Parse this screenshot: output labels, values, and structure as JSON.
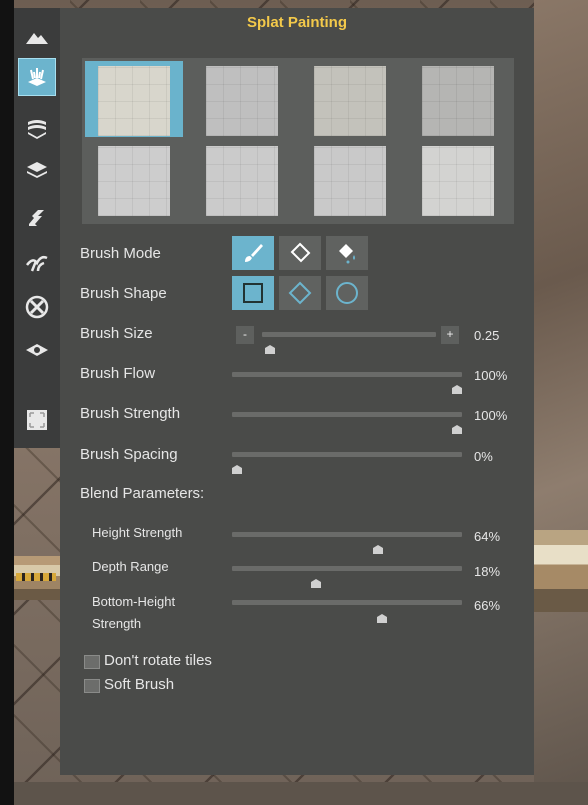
{
  "panel": {
    "title": "Splat Painting"
  },
  "sidebar": {
    "items": [
      {
        "name": "terrain-icon"
      },
      {
        "name": "splat-paint-icon",
        "active": true
      },
      {
        "name": "texture-layers-icon"
      },
      {
        "name": "layers-icon"
      },
      {
        "name": "path-tool-icon"
      },
      {
        "name": "vegetation-icon"
      },
      {
        "name": "remove-icon"
      },
      {
        "name": "eye-icon"
      },
      {
        "name": "fullscreen-icon"
      }
    ]
  },
  "tiles": [
    {
      "color": "#d8d6cc",
      "selected": true
    },
    {
      "color": "#bfbfbf"
    },
    {
      "color": "#c3c2bb"
    },
    {
      "color": "#b5b5b3"
    },
    {
      "color": "#cdcdcd"
    },
    {
      "color": "#cbcbcb"
    },
    {
      "color": "#c9c9c9"
    },
    {
      "color": "#d3d3d1"
    }
  ],
  "brush_mode": {
    "label": "Brush Mode",
    "options": [
      "brush-icon",
      "eraser-icon",
      "fill-bucket-icon"
    ],
    "selected": 0
  },
  "brush_shape": {
    "label": "Brush Shape",
    "options": [
      "square-shape-icon",
      "diamond-shape-icon",
      "circle-shape-icon"
    ],
    "selected": 0
  },
  "brush_size": {
    "label": "Brush Size",
    "value": "0.25",
    "minus": "-",
    "plus": "+",
    "fraction": 0.02
  },
  "brush_flow": {
    "label": "Brush Flow",
    "value": "100%",
    "fraction": 1.0
  },
  "brush_strength": {
    "label": "Brush Strength",
    "value": "100%",
    "fraction": 1.0
  },
  "brush_spacing": {
    "label": "Brush Spacing",
    "value": "0%",
    "fraction": 0.0
  },
  "blend": {
    "label": "Blend Parameters:",
    "height_strength": {
      "label": "Height Strength",
      "value": "64%",
      "fraction": 0.64
    },
    "depth_range": {
      "label": "Depth Range",
      "value": "18%",
      "fraction": 0.36
    },
    "bottom_height_strength": {
      "label_line1": "Bottom-Height",
      "label_line2": "Strength",
      "value": "66%",
      "fraction": 0.66
    }
  },
  "options": {
    "dont_rotate": {
      "label": "Don't rotate tiles",
      "checked": false
    },
    "soft_brush": {
      "label": "Soft Brush",
      "checked": false
    }
  },
  "colors": {
    "accent": "#6cb4cd",
    "title": "#f3c94a",
    "panel": "#4a4b49"
  }
}
